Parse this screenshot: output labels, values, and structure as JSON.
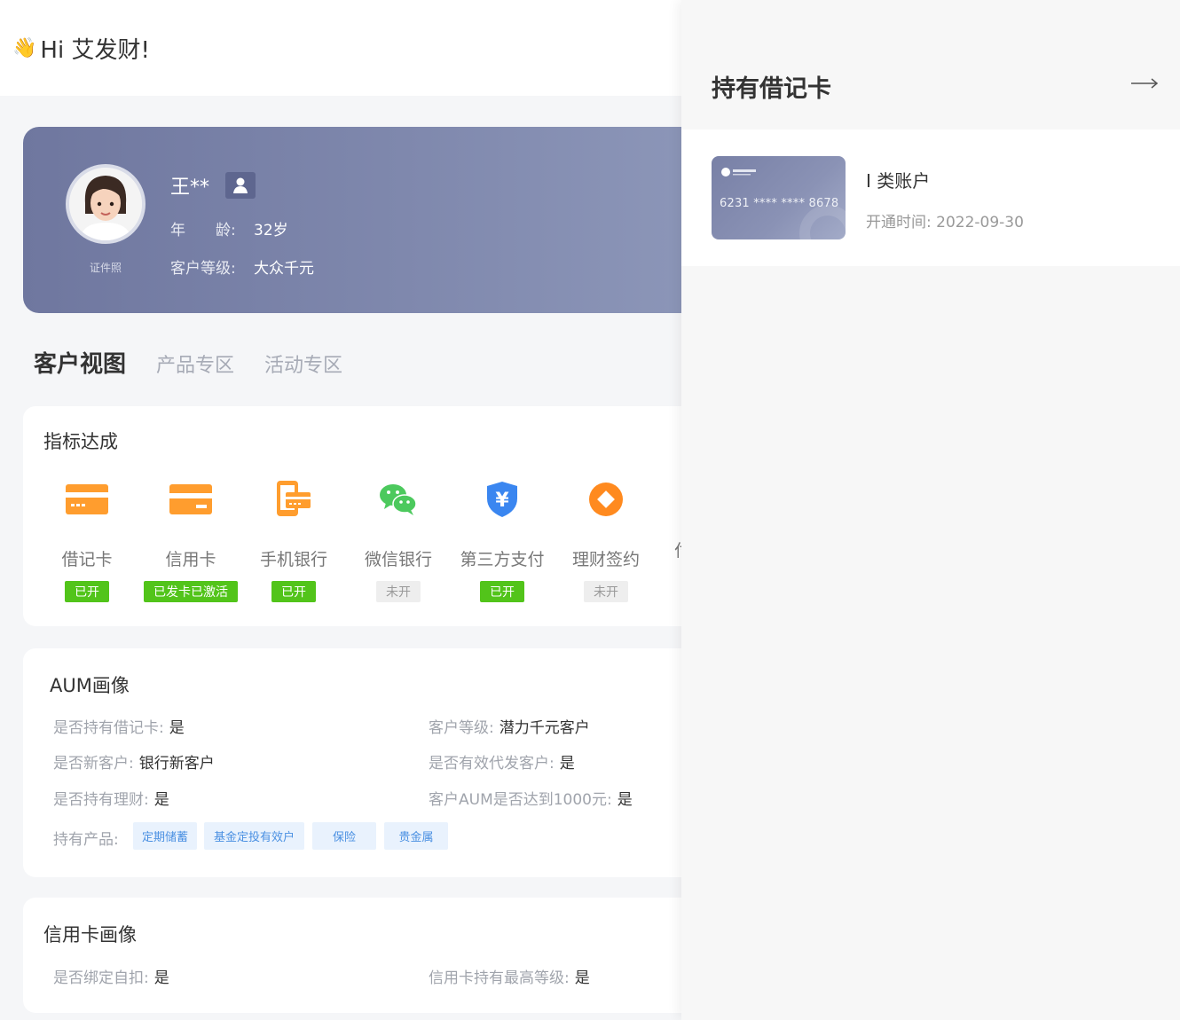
{
  "greeting": {
    "icon": "waving-hand-icon",
    "text": "Hi 艾发财!"
  },
  "profile": {
    "cert_label": "证件照",
    "name": "王**",
    "age_label": "年　　龄:",
    "age_value": "32岁",
    "level_label": "客户等级:",
    "level_value": "大众千元",
    "colors": {
      "banner_start": "#6f779f",
      "banner_end": "#8d97b9"
    }
  },
  "tabs": [
    {
      "label": "客户视图",
      "active": true
    },
    {
      "label": "产品专区",
      "active": false
    },
    {
      "label": "活动专区",
      "active": false
    }
  ],
  "metrics": {
    "title": "指标达成",
    "items": [
      {
        "label": "借记卡",
        "status": "已开",
        "on": true,
        "icon": "debit-card-icon"
      },
      {
        "label": "信用卡",
        "status": "已发卡已激活",
        "on": true,
        "icon": "credit-card-icon"
      },
      {
        "label": "手机银行",
        "status": "已开",
        "on": true,
        "icon": "mobile-banking-icon"
      },
      {
        "label": "微信银行",
        "status": "未开",
        "on": false,
        "icon": "wechat-icon"
      },
      {
        "label": "第三方支付",
        "status": "已开",
        "on": true,
        "icon": "yuan-shield-icon"
      },
      {
        "label": "理财签约",
        "status": "未开",
        "on": false,
        "icon": "wealth-icon"
      }
    ],
    "overflow_label": "付"
  },
  "aum": {
    "title": "AUM画像",
    "rows": [
      {
        "label": "是否持有借记卡:",
        "value": "是"
      },
      {
        "label": "客户等级:",
        "value": "潜力千元客户"
      },
      {
        "label": "是否新客户:",
        "value": "银行新客户"
      },
      {
        "label": "是否有效代发客户:",
        "value": "是"
      },
      {
        "label": "是否持有理财:",
        "value": "是"
      },
      {
        "label": "客户AUM是否达到1000元:",
        "value": "是"
      }
    ],
    "products_label": "持有产品:",
    "products": [
      "定期储蓄",
      "基金定投有效户",
      "保险",
      "贵金属"
    ]
  },
  "credit": {
    "title": "信用卡画像",
    "rows": [
      {
        "label": "是否绑定自扣:",
        "value": "是"
      },
      {
        "label": "信用卡持有最高等级:",
        "value": "是"
      }
    ]
  },
  "drawer": {
    "title": "持有借记卡",
    "arrow_icon": "arrow-right-icon",
    "card": {
      "number": "6231 **** **** 8678",
      "account_type": "I 类账户",
      "open_date_label": "开通时间:",
      "open_date": "2022-09-30"
    }
  }
}
